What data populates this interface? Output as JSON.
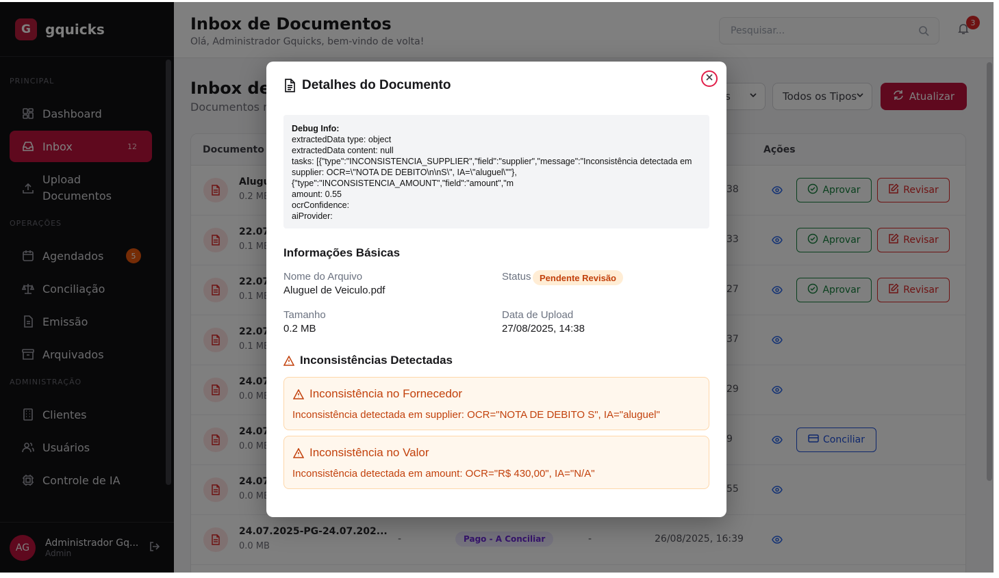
{
  "brand": {
    "logo_letter": "G",
    "name": "gquicks"
  },
  "sidebar": {
    "sections": {
      "principal": "PRINCIPAL",
      "operacoes": "OPERAÇÕES",
      "administracao": "ADMINISTRAÇÃO"
    },
    "items": [
      {
        "label": "Dashboard",
        "icon": "grid-icon"
      },
      {
        "label": "Inbox",
        "icon": "inbox-icon",
        "count": "12"
      },
      {
        "label": "Upload",
        "label2": "Documentos",
        "icon": "upload-icon"
      },
      {
        "label": "Agendados",
        "icon": "calendar-icon",
        "badge": "5"
      },
      {
        "label": "Conciliação",
        "icon": "scale-icon"
      },
      {
        "label": "Emissão",
        "icon": "document-icon"
      },
      {
        "label": "Arquivados",
        "icon": "archive-icon"
      },
      {
        "label": "Clientes",
        "icon": "building-icon"
      },
      {
        "label": "Usuários",
        "icon": "users-icon"
      },
      {
        "label": "Controle de IA",
        "icon": "cpu-icon"
      }
    ],
    "user": {
      "initials": "AG",
      "name": "Administrador Gq...",
      "role": "Admin"
    }
  },
  "header": {
    "title": "Inbox de Documentos",
    "subtitle": "Olá, Administrador Gquicks, bem-vindo de volta!",
    "search_placeholder": "Pesquisar...",
    "notifications": "3"
  },
  "main": {
    "title": "Inbox de D",
    "subtitle": "Documentos r",
    "filters": {
      "status_partial": "s",
      "type": "Todos os Tipos"
    },
    "refresh_label": "Atualizar",
    "columns": {
      "document": "Documento",
      "actions": "Ações"
    },
    "action_labels": {
      "approve": "Aprovar",
      "review": "Revisar",
      "reconcile": "Conciliar"
    },
    "rows": [
      {
        "name": "Alugu",
        "size": "0.2 MB",
        "date_tail": "38",
        "actions": "approve-review"
      },
      {
        "name": "22.07.",
        "size": "0.1 MB",
        "date_tail": "33",
        "actions": "approve-review"
      },
      {
        "name": "22.07.",
        "size": "0.1 MB",
        "date_tail": "27",
        "actions": "approve-review"
      },
      {
        "name": "22.07.",
        "size": "0.1 MB",
        "date_tail": "37",
        "actions": "none"
      },
      {
        "name": "24.07.",
        "size": "0.0 MB",
        "date_tail": "29",
        "actions": "none"
      },
      {
        "name": "24.07.",
        "size": "0.0 MB",
        "date_tail": "9",
        "actions": "reconcile"
      },
      {
        "name": "24.07.",
        "size": "0.0 MB",
        "date_tail": "55",
        "actions": "none"
      },
      {
        "name": "24.07.2025-PG-24.07.202...",
        "size": "0.0 MB",
        "dash1": "-",
        "status": "Pago - A Conciliar",
        "dash2": "-",
        "date": "26/08/2025, 16:39",
        "actions": "none"
      }
    ]
  },
  "modal": {
    "title": "Detalhes do Documento",
    "debug": {
      "heading": "Debug Info:",
      "line1": "extractedData type: object",
      "line2": "extractedData content: null",
      "line3": "tasks: [{\"type\":\"INCONSISTENCIA_SUPPLIER\",\"field\":\"supplier\",\"message\":\"Inconsistência detectada em supplier: OCR=\\\"NOTA DE DEBITO\\n\\nS\\\", IA=\\\"aluguel\\\"\"},",
      "line4": "{\"type\":\"INCONSISTENCIA_AMOUNT\",\"field\":\"amount\",\"m",
      "line5": "amount: 0.55",
      "line6": "ocrConfidence:",
      "line7": "aiProvider:"
    },
    "basic": {
      "title": "Informações Básicas",
      "file_label": "Nome do Arquivo",
      "file_value": "Aluguel de Veiculo.pdf",
      "status_label": "Status",
      "status_value": "Pendente Revisão",
      "size_label": "Tamanho",
      "size_value": "0.2 MB",
      "date_label": "Data de Upload",
      "date_value": "27/08/2025, 14:38"
    },
    "inconsistencies": {
      "title": "Inconsistências Detectadas",
      "items": [
        {
          "title": "Inconsistência no Fornecedor",
          "message": "Inconsistência detectada em supplier: OCR=\"NOTA DE DEBITO S\", IA=\"aluguel\""
        },
        {
          "title": "Inconsistência no Valor",
          "message": "Inconsistência detectada em amount: OCR=\"R$ 430,00\", IA=\"N/A\""
        }
      ]
    }
  },
  "colors": {
    "brand": "#be123c",
    "warning": "#c2410c",
    "success": "#15803d",
    "info": "#1d4ed8"
  }
}
